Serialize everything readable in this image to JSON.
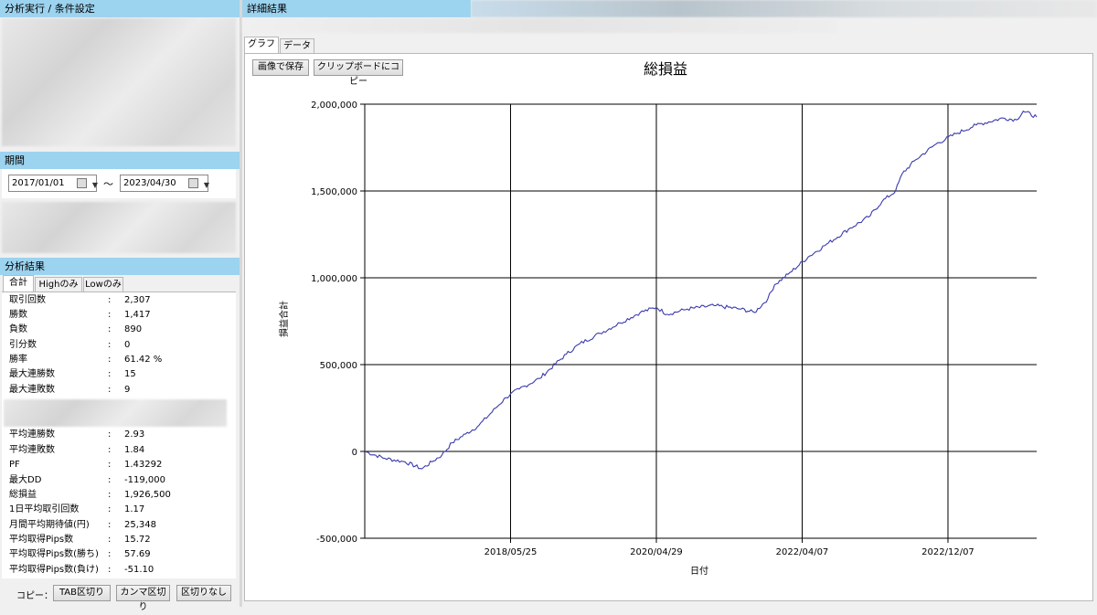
{
  "left": {
    "analysis_header": "分析実行 / 条件設定",
    "period_header": "期間",
    "period_from": "2017/01/01",
    "period_sep": "～",
    "period_to": "2023/04/30",
    "results_header": "分析結果",
    "tabs": [
      "合計",
      "Highのみ",
      "Lowのみ"
    ],
    "stats_a": [
      {
        "label": "取引回数",
        "value": "2,307"
      },
      {
        "label": "勝数",
        "value": "1,417"
      },
      {
        "label": "負数",
        "value": "890"
      },
      {
        "label": "引分数",
        "value": "0"
      },
      {
        "label": "勝率",
        "value": "61.42 %"
      },
      {
        "label": "最大連勝数",
        "value": "15"
      },
      {
        "label": "最大連敗数",
        "value": "9"
      }
    ],
    "stats_b": [
      {
        "label": "平均連勝数",
        "value": "2.93"
      },
      {
        "label": "平均連敗数",
        "value": "1.84"
      },
      {
        "label": "PF",
        "value": "1.43292"
      },
      {
        "label": "最大DD",
        "value": "-119,000"
      },
      {
        "label": "総損益",
        "value": "1,926,500"
      },
      {
        "label": "1日平均取引回数",
        "value": "1.17"
      },
      {
        "label": "月間平均期待値(円)",
        "value": "25,348"
      },
      {
        "label": "平均取得Pips数",
        "value": "15.72"
      },
      {
        "label": "平均取得Pips数(勝ち)",
        "value": "57.69"
      },
      {
        "label": "平均取得Pips数(負け)",
        "value": "-51.10"
      }
    ],
    "colon": ":",
    "copy_label": "コピー：",
    "copy_buttons": [
      "TAB区切り",
      "カンマ区切り",
      "区切りなし"
    ]
  },
  "right": {
    "header": "詳細結果",
    "tabs": [
      "グラフ",
      "データ"
    ],
    "save_image": "画像で保存",
    "copy_clipboard": "クリップボードにコピー"
  },
  "chart_data": {
    "type": "line",
    "title": "総損益",
    "xlabel": "日付",
    "ylabel": "損益合計",
    "ylim": [
      -500000,
      2000000
    ],
    "yticks": [
      "2,000,000",
      "1,500,000",
      "1,000,000",
      "500,000",
      "0",
      "-500,000"
    ],
    "ytick_values": [
      2000000,
      1500000,
      1000000,
      500000,
      0,
      -500000
    ],
    "xticks": [
      "2018/05/25",
      "2020/04/29",
      "2022/04/07",
      "2022/12/07"
    ],
    "xtick_fractions": [
      0.217,
      0.434,
      0.651,
      0.868
    ],
    "grid": true,
    "line_color": "#3a3aad",
    "series": [
      {
        "x": [
          0,
          0.03,
          0.06,
          0.085,
          0.1,
          0.115,
          0.13,
          0.15,
          0.17,
          0.195,
          0.21,
          0.23,
          0.26,
          0.3,
          0.32,
          0.35,
          0.38,
          0.41,
          0.434,
          0.45,
          0.48,
          0.52,
          0.56,
          0.58,
          0.6,
          0.61,
          0.63,
          0.66,
          0.69,
          0.72,
          0.75,
          0.77,
          0.79,
          0.8,
          0.82,
          0.85,
          0.88,
          0.91,
          0.95,
          0.97,
          0.98,
          1.0
        ],
        "y": [
          0,
          -40000,
          -60000,
          -100000,
          -60000,
          -20000,
          50000,
          100000,
          150000,
          250000,
          310000,
          360000,
          420000,
          560000,
          620000,
          680000,
          740000,
          800000,
          830000,
          790000,
          820000,
          840000,
          820000,
          800000,
          880000,
          960000,
          1020000,
          1120000,
          1200000,
          1280000,
          1350000,
          1440000,
          1500000,
          1600000,
          1680000,
          1770000,
          1830000,
          1880000,
          1920000,
          1910000,
          1960000,
          1926500
        ]
      }
    ]
  }
}
